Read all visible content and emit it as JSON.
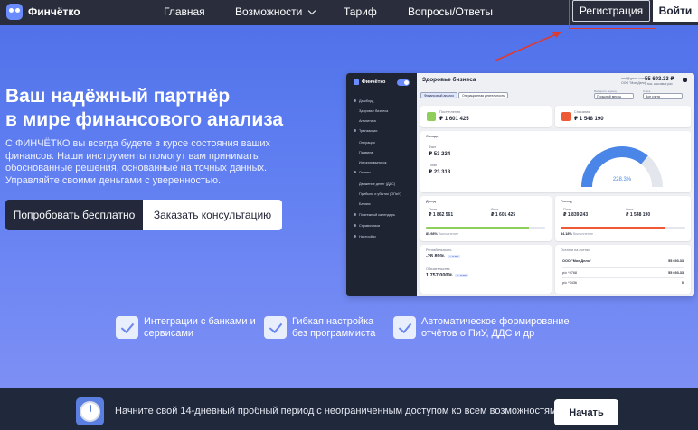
{
  "nav": {
    "brand": "Финчётко",
    "links": [
      "Главная",
      "Возможности",
      "Тариф",
      "Вопросы/Ответы"
    ],
    "register": "Регистрация",
    "login": "Войти"
  },
  "hero": {
    "title_line1": "Ваш надёжный партнёр",
    "title_line2": "в мире финансового анализа",
    "description": "С ФИНЧЁТКО вы всегда будете в курсе состояния ваших финансов. Наши инструменты помогут вам принимать обоснованные решения, основанные на точных данных. Управляйте своими деньгами с уверенностью.",
    "cta_primary": "Попробовать бесплатно",
    "cta_secondary": "Заказать консультацию"
  },
  "dashboard": {
    "brand": "Финчётко",
    "title": "Здоровье бизнеса",
    "user_email": "mail@gmail.com",
    "user_company": "ООО \"Мое Дело\"",
    "balance": "55 693.33 ₽",
    "balance_sub": "1 тыс. кассовых раз",
    "sidebar": [
      "Дашборд",
      "Здоровье бизнеса",
      "Аналитика",
      "Транзакции",
      "Операции",
      "Правила",
      "История выписок",
      "Отчеты",
      "Движение денег (ДДС)",
      "Прибыли и убытки (ОПиУ)",
      "Баланс",
      "Платежный календарь",
      "Справочники",
      "Настройки"
    ],
    "pills": [
      "Финансовый анализ",
      "Операционная деятельность"
    ],
    "period_label": "Выберите период",
    "period_value": "Прошлый месяц",
    "account_label": "Счета",
    "account_value": "Все счета",
    "income_label": "Поступления",
    "income_value": "₽ 1 601 425",
    "expense_label": "Списания",
    "expense_value": "₽ 1 548 190",
    "saldo_title": "Сальдо",
    "saldo_fact_label": "Факт",
    "saldo_fact": "₽ 53 234",
    "saldo_plan_label": "План",
    "saldo_plan": "₽ 23 318",
    "gauge_value": "228.3%",
    "gauge_fraction": 0.72,
    "revenue_title": "Доход",
    "rev_plan_label": "План",
    "rev_plan": "₽ 1 862 561",
    "rev_fact_label": "Факт",
    "rev_fact": "₽ 1 601 425",
    "rev_pct": "85.98%",
    "rev_pct_label": "Выполнение",
    "rev_fraction": 0.86,
    "cost_title": "Расход",
    "cost_plan_label": "План",
    "cost_plan": "₽ 1 839 243",
    "cost_fact_label": "Факт",
    "cost_fact": "₽ 1 548 190",
    "cost_pct": "84.18%",
    "cost_pct_label": "Выполнение",
    "cost_fraction": 0.84,
    "profitability_label": "Рентабельность",
    "profitability": "-28.89%",
    "profitability_badge": "▲ 0.9%",
    "obligations_label": "Обязательства",
    "obligations": "1 757 000%",
    "obligations_badge": "▲ 0.9%",
    "accounts_title": "Остатки на счетах",
    "accounts": [
      {
        "name": "ООО \"Мое Дело\"",
        "value": "55 693.33"
      },
      {
        "name": "р/с *4768",
        "value": "55 693.33"
      },
      {
        "name": "р/с *3436",
        "value": "0"
      }
    ]
  },
  "features": [
    {
      "line1": "Интеграции с банками и",
      "line2": "сервисами"
    },
    {
      "line1": "Гибкая настройка",
      "line2": "без программиста"
    },
    {
      "line1": "Автоматическое формирование",
      "line2": "отчётов о ПиУ, ДДС и др"
    }
  ],
  "footer": {
    "text": "Начните свой 14-дневный пробный период с неограниченным доступом ко всем возможностям",
    "start": "Начать"
  },
  "colors": {
    "accent": "#6a86ef",
    "dark": "#23283a",
    "annotation": "#e03a2d",
    "income": "#8fce5a",
    "expense": "#ef5a36",
    "gauge": "#4a86e8"
  }
}
